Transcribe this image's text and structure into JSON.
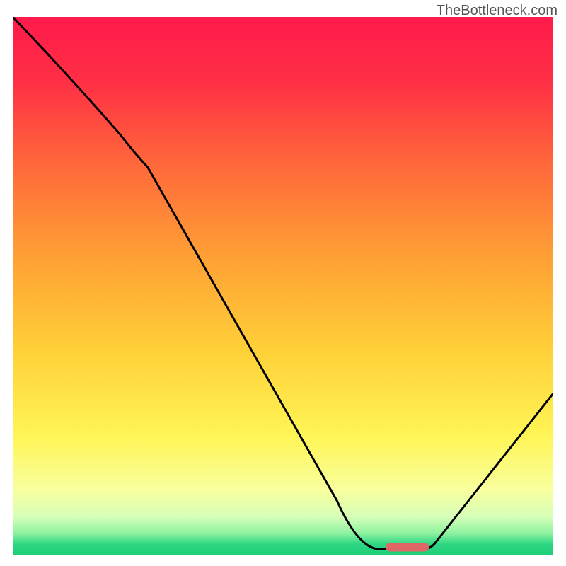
{
  "watermark": "TheBottleneck.com",
  "chart_data": {
    "type": "line",
    "title": "",
    "xlabel": "",
    "ylabel": "",
    "xlim": [
      0,
      100
    ],
    "ylim": [
      0,
      100
    ],
    "grid": false,
    "legend": false,
    "annotations": [],
    "series": [
      {
        "name": "curve",
        "x": [
          0,
          20,
          25,
          60,
          68,
          76,
          78,
          100
        ],
        "values": [
          100,
          78,
          72,
          10,
          1,
          1,
          2,
          30
        ]
      }
    ],
    "marker": {
      "shape": "rounded-rect",
      "x_start": 69,
      "x_end": 77,
      "y": 0.8,
      "color": "#e06666"
    },
    "background_gradient": {
      "stops": [
        {
          "pct": 0,
          "color": "#ff1a4b"
        },
        {
          "pct": 12,
          "color": "#ff2f45"
        },
        {
          "pct": 28,
          "color": "#ff6a3a"
        },
        {
          "pct": 45,
          "color": "#ffa135"
        },
        {
          "pct": 62,
          "color": "#ffd038"
        },
        {
          "pct": 78,
          "color": "#fff556"
        },
        {
          "pct": 88,
          "color": "#f8ff9e"
        },
        {
          "pct": 93,
          "color": "#d6ffb8"
        },
        {
          "pct": 96,
          "color": "#8ef2a0"
        },
        {
          "pct": 98,
          "color": "#2fd784"
        },
        {
          "pct": 100,
          "color": "#1ecf78"
        }
      ]
    }
  }
}
